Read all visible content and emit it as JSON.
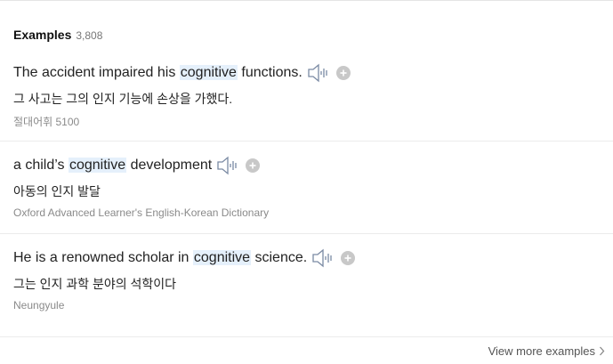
{
  "header": {
    "title": "Examples",
    "count": "3,808"
  },
  "examples": [
    {
      "before": "The accident impaired his ",
      "keyword": "cognitive",
      "after": " functions.",
      "translation": "그 사고는 그의 인지 기능에 손상을 가했다.",
      "source": "절대어휘 5100",
      "speaker_icon": "speaker-icon",
      "add_icon": "plus-circle-icon"
    },
    {
      "before": "a child’s ",
      "keyword": "cognitive",
      "after": " development",
      "translation": "아동의 인지 발달",
      "source": "Oxford Advanced Learner's English-Korean Dictionary",
      "speaker_icon": "speaker-icon",
      "add_icon": "plus-circle-icon"
    },
    {
      "before": "He is a renowned scholar in ",
      "keyword": "cognitive",
      "after": " science.",
      "translation": "그는 인지 과학 분야의 석학이다",
      "source": "Neungyule",
      "speaker_icon": "speaker-icon",
      "add_icon": "plus-circle-icon"
    }
  ],
  "footer": {
    "view_more": "View more examples",
    "chevron_icon": "chevron-right-icon"
  },
  "colors": {
    "highlight": "#e5f0fb",
    "speaker": "#7a8aa3",
    "plus": "#c8c8c8",
    "source_text": "#8a8a8a"
  }
}
